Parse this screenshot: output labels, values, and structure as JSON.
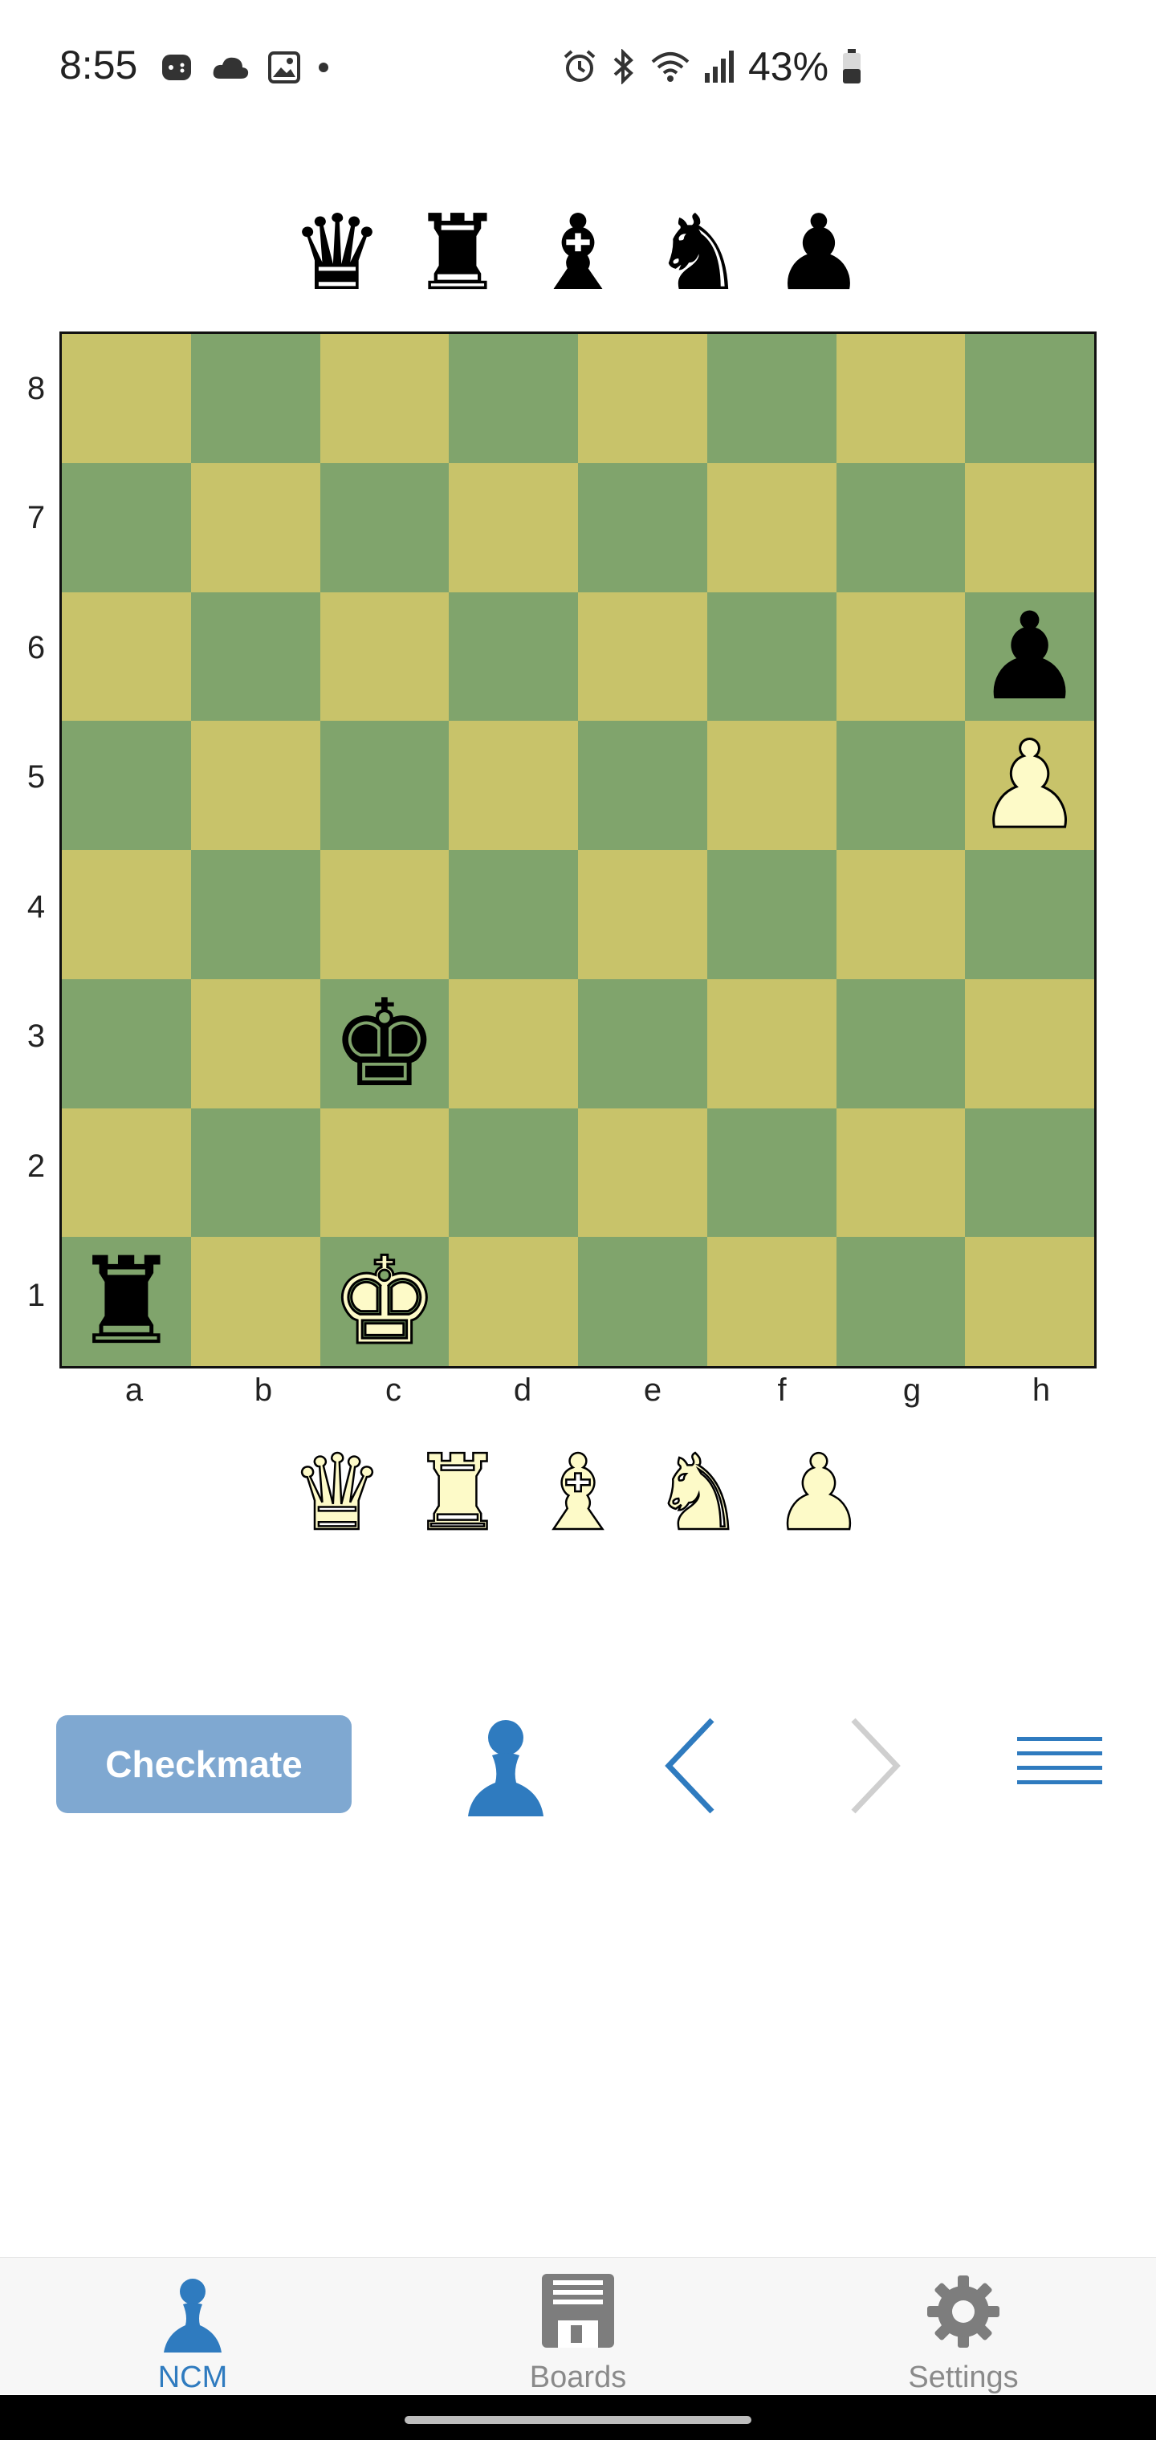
{
  "status_bar": {
    "time": "8:55",
    "battery_percent": "43%",
    "left_icons": [
      "game-icon",
      "cloud-icon",
      "gallery-icon",
      "dot-icon"
    ],
    "right_icons": [
      "alarm-icon",
      "bluetooth-icon",
      "wifi-icon",
      "signal-icon",
      "battery-icon"
    ]
  },
  "captured": {
    "top": [
      "♛",
      "♜",
      "♝",
      "♞",
      "♟"
    ],
    "bottom": [
      "♛",
      "♜",
      "♝",
      "♞",
      "♟"
    ]
  },
  "board": {
    "ranks": [
      "8",
      "7",
      "6",
      "5",
      "4",
      "3",
      "2",
      "1"
    ],
    "files": [
      "a",
      "b",
      "c",
      "d",
      "e",
      "f",
      "g",
      "h"
    ],
    "colors": {
      "light": "#c8c36a",
      "dark": "#80a46c"
    },
    "pieces": [
      {
        "square": "h6",
        "glyph": "♟",
        "color": "black"
      },
      {
        "square": "h5",
        "glyph": "♟",
        "color": "white"
      },
      {
        "square": "c3",
        "glyph": "♚",
        "color": "black"
      },
      {
        "square": "a1",
        "glyph": "♜",
        "color": "black"
      },
      {
        "square": "c1",
        "glyph": "♚",
        "color": "white"
      }
    ]
  },
  "controls": {
    "checkmate_label": "Checkmate",
    "turn_icon": "pawn-icon",
    "accent": "#2f7bbf"
  },
  "bottom_nav": {
    "items": [
      {
        "label": "NCM",
        "icon": "pawn-icon",
        "active": true
      },
      {
        "label": "Boards",
        "icon": "floppy-disk-icon",
        "active": false
      },
      {
        "label": "Settings",
        "icon": "gear-icon",
        "active": false
      }
    ]
  }
}
